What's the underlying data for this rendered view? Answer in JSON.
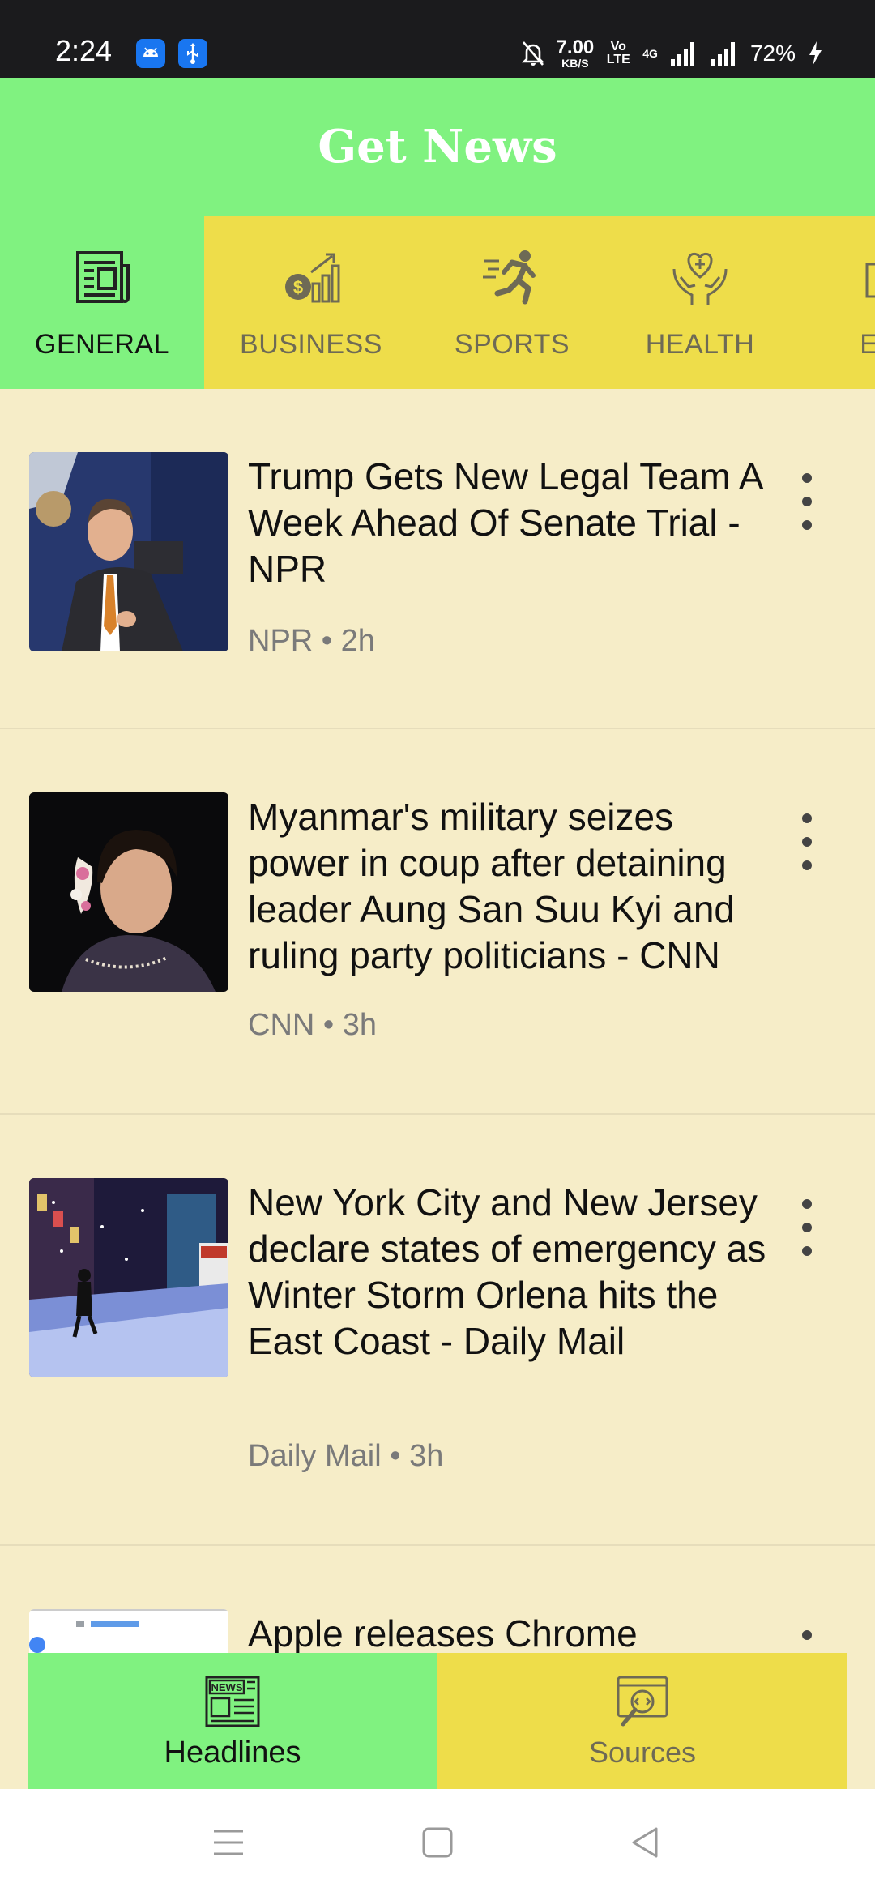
{
  "status_bar": {
    "time": "2:24",
    "net_speed_value": "7.00",
    "net_speed_unit": "KB/S",
    "volte": "Vo LTE",
    "network": "4G",
    "battery": "72%"
  },
  "app": {
    "title": "Get News"
  },
  "categories": [
    {
      "label": "GENERAL",
      "icon": "newspaper-icon",
      "active": true
    },
    {
      "label": "BUSINESS",
      "icon": "business-chart-icon",
      "active": false
    },
    {
      "label": "SPORTS",
      "icon": "runner-icon",
      "active": false
    },
    {
      "label": "HEALTH",
      "icon": "health-hands-icon",
      "active": false
    },
    {
      "label": "ENT",
      "icon": "entertainment-icon",
      "active": false
    }
  ],
  "articles": [
    {
      "headline": "Trump Gets New Legal Team A Week Ahead Of Senate Trial - NPR",
      "meta": "NPR • 2h"
    },
    {
      "headline": "Myanmar's military seizes power in coup after detaining leader Aung San Suu Kyi and ruling party politicians - CNN",
      "meta": "CNN • 3h"
    },
    {
      "headline": "New York City and New Jersey declare states of emergency as Winter Storm Orlena hits the East Coast - Daily Mail",
      "meta": "Daily Mail • 3h"
    },
    {
      "headline": "Apple releases Chrome",
      "meta": ""
    }
  ],
  "bottom_nav": [
    {
      "label": "Headlines",
      "icon": "news-icon",
      "active": true
    },
    {
      "label": "Sources",
      "icon": "source-code-icon",
      "active": false
    }
  ],
  "colors": {
    "accent_green": "#80F280",
    "accent_yellow": "#EEDD4A",
    "background": "#F6EDC8"
  }
}
